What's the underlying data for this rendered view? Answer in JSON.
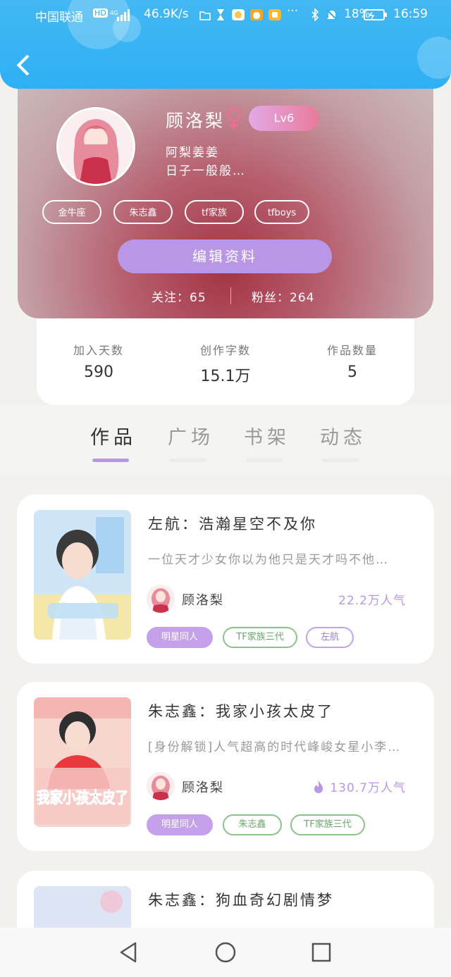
{
  "status_bar": {
    "carrier": "中国联通",
    "network_speed": "46.9K/s",
    "battery": "18%",
    "time": "16:59"
  },
  "profile": {
    "name": "顾洛梨",
    "level": "Lv6",
    "signature_line1": "阿梨姜姜",
    "signature_line2": "日子一般般…",
    "tags": [
      "金牛座",
      "朱志鑫",
      "tf家族",
      "tfboys"
    ],
    "edit_button": "编辑资料",
    "following_label": "关注：",
    "following_count": "65",
    "fans_label": "粉丝：",
    "fans_count": "264"
  },
  "stats": [
    {
      "label": "加入天数",
      "value": "590"
    },
    {
      "label": "创作字数",
      "value": "15.1万"
    },
    {
      "label": "作品数量",
      "value": "5"
    }
  ],
  "tabs": [
    "作品",
    "广场",
    "书架",
    "动态"
  ],
  "active_tab": "作品",
  "works": [
    {
      "title": "左航：浩瀚星空不及你",
      "description": "一位天才少女你以为他只是天才吗不他…",
      "author": "顾洛梨",
      "popularity": "22.2万人气",
      "tags": [
        "明星同人",
        "TF家族三代",
        "左航"
      ]
    },
    {
      "title": "朱志鑫：我家小孩太皮了",
      "description": "[身份解锁]人气超高的时代峰峻女星小李…",
      "author": "顾洛梨",
      "popularity": "130.7万人气",
      "tags": [
        "明星同人",
        "朱志鑫",
        "TF家族三代"
      ],
      "cover_text": "我家小孩太皮了"
    },
    {
      "title": "朱志鑫：狗血奇幻剧情梦"
    }
  ],
  "colors": {
    "accent": "#b997e6",
    "topbar": "#2eb0f5",
    "tag_green": "#8dc28b"
  },
  "icons": [
    "back-arrow-icon",
    "female-icon",
    "flame-icon",
    "nav-back-icon",
    "nav-home-icon",
    "nav-recent-icon"
  ]
}
